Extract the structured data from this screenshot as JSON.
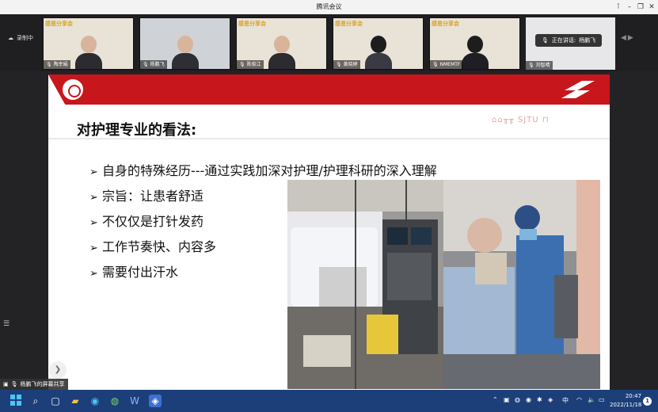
{
  "window": {
    "title": "腾讯会议"
  },
  "recording": {
    "label": "录制中"
  },
  "participants": [
    {
      "name": "陶幸娟"
    },
    {
      "name": "杨鹏飞"
    },
    {
      "name": "陈俊江"
    },
    {
      "name": "黄晓婷"
    },
    {
      "name": "NMEMTF"
    },
    {
      "name": "刘智晴"
    }
  ],
  "tile_banner": "感恩分享会",
  "speaking": {
    "label": "正在讲话:",
    "name": "杨鹏飞"
  },
  "slide": {
    "title": "对护理专业的看法:",
    "skyline_text": "SJTU",
    "bullets": [
      "自身的特殊经历---通过实践加深对护理/护理科研的深入理解",
      "宗旨：让患者舒适",
      "不仅仅是打针发药",
      "工作节奏快、内容多",
      "需要付出汗水"
    ]
  },
  "share": {
    "label": "杨鹏飞的屏幕共享"
  },
  "taskbar": {
    "ime": "中",
    "time": "20:47",
    "date": "2022/11/18",
    "notification_count": "1"
  },
  "colors": {
    "accent": "#c8161d",
    "taskbar": "#1c3f7a"
  }
}
